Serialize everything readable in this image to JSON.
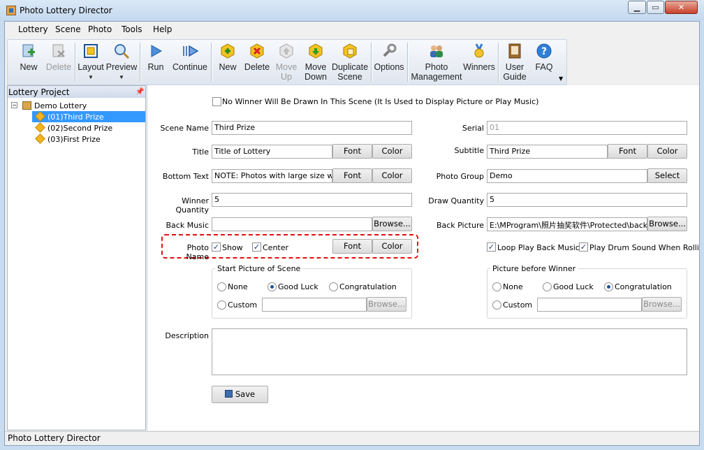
{
  "window": {
    "title": "Photo Lottery Director"
  },
  "menu": [
    "Lottery",
    "Scene",
    "Photo",
    "Tools",
    "Help"
  ],
  "toolbar": {
    "new": "New",
    "delete": "Delete",
    "layout": "Layout",
    "preview": "Preview",
    "run": "Run",
    "continue": "Continue",
    "scene_new": "New",
    "scene_delete": "Delete",
    "move_up_1": "Move",
    "move_up_2": "Up",
    "move_down_1": "Move",
    "move_down_2": "Down",
    "duplicate_1": "Duplicate",
    "duplicate_2": "Scene",
    "options": "Options",
    "photo_mgmt_1": "Photo",
    "photo_mgmt_2": "Management",
    "winners": "Winners",
    "user_guide_1": "User",
    "user_guide_2": "Guide",
    "faq": "FAQ"
  },
  "sidebar": {
    "title": "Lottery Project",
    "root": "Demo Lottery",
    "items": [
      "(01)Third Prize",
      "(02)Second Prize",
      "(03)First Prize"
    ],
    "selected": 0
  },
  "form": {
    "no_winner": "No Winner Will Be Drawn In This Scene   (It Is Used to Display Picture or Play Music)",
    "scene_name_label": "Scene Name",
    "scene_name": "Third Prize",
    "serial_label": "Serial",
    "serial": "01",
    "title_label": "Title",
    "title": "Title of Lottery",
    "subtitle_label": "Subtitle",
    "subtitle": "Third Prize",
    "bottom_text_label": "Bottom Text",
    "bottom_text": "NOTE: Photos with large size will make",
    "photo_group_label": "Photo Group",
    "photo_group": "Demo",
    "winner_qty_label": "Winner Quantity",
    "winner_qty": "5",
    "draw_qty_label": "Draw Quantity",
    "draw_qty": "5",
    "back_music_label": "Back Music",
    "back_music": "",
    "back_picture_label": "Back Picture",
    "back_picture": "E:\\MProgram\\照片抽奖软件\\Protected\\back.jpg",
    "photo_name_label": "Photo Name",
    "show": "Show",
    "center": "Center",
    "loop_music": "Loop Play Back Music",
    "play_drum": "Play Drum Sound When Rolling Photos",
    "font": "Font",
    "color": "Color",
    "browse": "Browse...",
    "select": "Select",
    "start_picture": "Start Picture of Scene",
    "before_winner": "Picture before Winner",
    "none": "None",
    "good_luck": "Good Luck",
    "congratulation": "Congratulation",
    "custom": "Custom",
    "description_label": "Description",
    "description": "",
    "save": "Save"
  },
  "status": "Photo Lottery Director"
}
